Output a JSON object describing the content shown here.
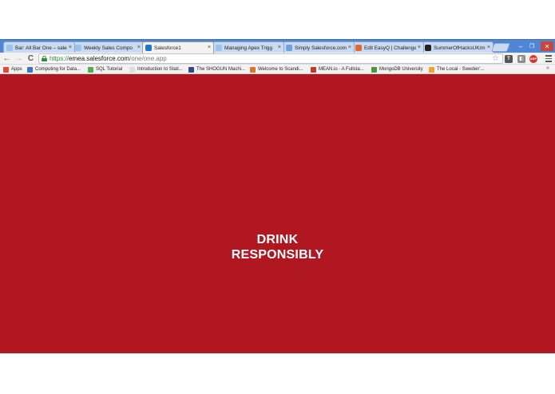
{
  "browser": {
    "tabs": [
      {
        "title": "Bar: All Bar One – sale",
        "favicon": "salesforce-cloud-icon",
        "active": false
      },
      {
        "title": "Weekly Sales Compo",
        "favicon": "salesforce-cloud-icon",
        "active": false
      },
      {
        "title": "Salesforce1",
        "favicon": "salesforce1-icon",
        "active": true
      },
      {
        "title": "Managing Apex Trigg",
        "favicon": "salesforce-cloud-icon",
        "active": false
      },
      {
        "title": "Simply Salesforce.com",
        "favicon": "simply-salesforce-icon",
        "active": false
      },
      {
        "title": "Edit EasyQ | Challenge",
        "favicon": "devpost-icon",
        "active": false
      },
      {
        "title": "SummerOfHacksUK/m",
        "favicon": "github-icon",
        "active": false
      }
    ],
    "close_glyph": "×",
    "window_controls": {
      "minimize": "–",
      "maximize": "❐",
      "close": "✕"
    },
    "nav": {
      "back": "←",
      "forward": "→",
      "reload": "C"
    },
    "url": {
      "scheme": "https://",
      "host": "emea.salesforce.com",
      "path": "/one/one.app"
    },
    "star_glyph": "☆",
    "extensions": [
      {
        "name": "todoist-extension-icon",
        "label": "T",
        "color": "#555555"
      },
      {
        "name": "pocket-extension-icon",
        "label": "◧",
        "color": "#8a8a8a"
      },
      {
        "name": "adblock-extension-icon",
        "label": "ABP",
        "color": "#d9342b"
      }
    ],
    "bookmarks": [
      {
        "label": "Apps",
        "icon": "apps-grid-icon",
        "color": "#e24a3b"
      },
      {
        "label": "Computing for Data...",
        "icon": "bookmark-site-icon",
        "color": "#3d72c4"
      },
      {
        "label": "SQL Tutorial",
        "icon": "w3schools-icon",
        "color": "#4caf50"
      },
      {
        "label": "Introduction to Stati...",
        "icon": "page-icon",
        "color": "#dddddd"
      },
      {
        "label": "The SHOGUN Machi...",
        "icon": "shogun-icon",
        "color": "#2b4a8a"
      },
      {
        "label": "Welcome to Scandi...",
        "icon": "scandi-icon",
        "color": "#e0742b"
      },
      {
        "label": "MEAN.io - A Fullsta...",
        "icon": "mean-icon",
        "color": "#c0392b"
      },
      {
        "label": "MongoDB University",
        "icon": "mongodb-leaf-icon",
        "color": "#4a9a3c"
      },
      {
        "label": "The Local - Sweden'...",
        "icon": "thelocal-icon",
        "color": "#f0a22b"
      }
    ],
    "bookmarks_more": "»"
  },
  "app": {
    "background_color": "#b01720",
    "splash_line1": "DRINK",
    "splash_line2": "RESPONSIBLY"
  }
}
